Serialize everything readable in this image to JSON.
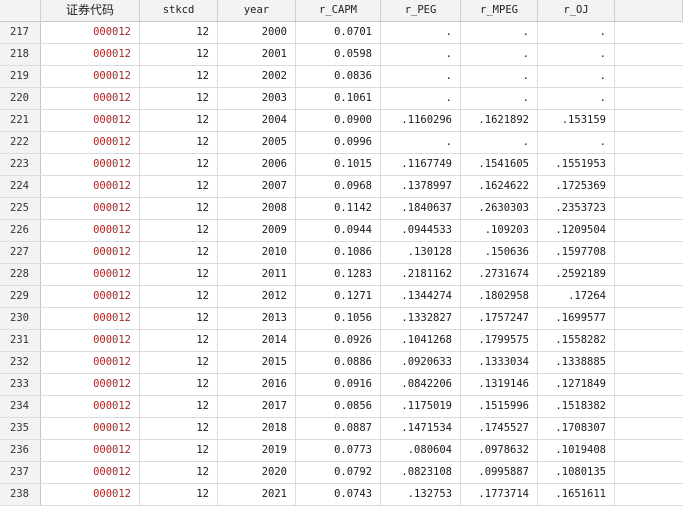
{
  "headers": {
    "code": "证券代码",
    "stkcd": "stkcd",
    "year": "year",
    "r_capm": "r_CAPM",
    "r_peg": "r_PEG",
    "r_mpeg": "r_MPEG",
    "r_oj": "r_OJ"
  },
  "colors": {
    "code_text": "#a52a2a",
    "header_bg": "#f3f3f3",
    "grid_line": "#dcdcdc"
  },
  "rows": [
    {
      "n": "217",
      "code": "000012",
      "stkcd": "12",
      "year": "2000",
      "r_capm": "0.0701",
      "r_peg": ".",
      "r_mpeg": ".",
      "r_oj": "."
    },
    {
      "n": "218",
      "code": "000012",
      "stkcd": "12",
      "year": "2001",
      "r_capm": "0.0598",
      "r_peg": ".",
      "r_mpeg": ".",
      "r_oj": "."
    },
    {
      "n": "219",
      "code": "000012",
      "stkcd": "12",
      "year": "2002",
      "r_capm": "0.0836",
      "r_peg": ".",
      "r_mpeg": ".",
      "r_oj": "."
    },
    {
      "n": "220",
      "code": "000012",
      "stkcd": "12",
      "year": "2003",
      "r_capm": "0.1061",
      "r_peg": ".",
      "r_mpeg": ".",
      "r_oj": "."
    },
    {
      "n": "221",
      "code": "000012",
      "stkcd": "12",
      "year": "2004",
      "r_capm": "0.0900",
      "r_peg": ".1160296",
      "r_mpeg": ".1621892",
      "r_oj": ".153159"
    },
    {
      "n": "222",
      "code": "000012",
      "stkcd": "12",
      "year": "2005",
      "r_capm": "0.0996",
      "r_peg": ".",
      "r_mpeg": ".",
      "r_oj": "."
    },
    {
      "n": "223",
      "code": "000012",
      "stkcd": "12",
      "year": "2006",
      "r_capm": "0.1015",
      "r_peg": ".1167749",
      "r_mpeg": ".1541605",
      "r_oj": ".1551953"
    },
    {
      "n": "224",
      "code": "000012",
      "stkcd": "12",
      "year": "2007",
      "r_capm": "0.0968",
      "r_peg": ".1378997",
      "r_mpeg": ".1624622",
      "r_oj": ".1725369"
    },
    {
      "n": "225",
      "code": "000012",
      "stkcd": "12",
      "year": "2008",
      "r_capm": "0.1142",
      "r_peg": ".1840637",
      "r_mpeg": ".2630303",
      "r_oj": ".2353723"
    },
    {
      "n": "226",
      "code": "000012",
      "stkcd": "12",
      "year": "2009",
      "r_capm": "0.0944",
      "r_peg": ".0944533",
      "r_mpeg": ".109203",
      "r_oj": ".1209504"
    },
    {
      "n": "227",
      "code": "000012",
      "stkcd": "12",
      "year": "2010",
      "r_capm": "0.1086",
      "r_peg": ".130128",
      "r_mpeg": ".150636",
      "r_oj": ".1597708"
    },
    {
      "n": "228",
      "code": "000012",
      "stkcd": "12",
      "year": "2011",
      "r_capm": "0.1283",
      "r_peg": ".2181162",
      "r_mpeg": ".2731674",
      "r_oj": ".2592189"
    },
    {
      "n": "229",
      "code": "000012",
      "stkcd": "12",
      "year": "2012",
      "r_capm": "0.1271",
      "r_peg": ".1344274",
      "r_mpeg": ".1802958",
      "r_oj": ".17264"
    },
    {
      "n": "230",
      "code": "000012",
      "stkcd": "12",
      "year": "2013",
      "r_capm": "0.1056",
      "r_peg": ".1332827",
      "r_mpeg": ".1757247",
      "r_oj": ".1699577"
    },
    {
      "n": "231",
      "code": "000012",
      "stkcd": "12",
      "year": "2014",
      "r_capm": "0.0926",
      "r_peg": ".1041268",
      "r_mpeg": ".1799575",
      "r_oj": ".1558282"
    },
    {
      "n": "232",
      "code": "000012",
      "stkcd": "12",
      "year": "2015",
      "r_capm": "0.0886",
      "r_peg": ".0920633",
      "r_mpeg": ".1333034",
      "r_oj": ".1338885"
    },
    {
      "n": "233",
      "code": "000012",
      "stkcd": "12",
      "year": "2016",
      "r_capm": "0.0916",
      "r_peg": ".0842206",
      "r_mpeg": ".1319146",
      "r_oj": ".1271849"
    },
    {
      "n": "234",
      "code": "000012",
      "stkcd": "12",
      "year": "2017",
      "r_capm": "0.0856",
      "r_peg": ".1175019",
      "r_mpeg": ".1515996",
      "r_oj": ".1518382"
    },
    {
      "n": "235",
      "code": "000012",
      "stkcd": "12",
      "year": "2018",
      "r_capm": "0.0887",
      "r_peg": ".1471534",
      "r_mpeg": ".1745527",
      "r_oj": ".1708307"
    },
    {
      "n": "236",
      "code": "000012",
      "stkcd": "12",
      "year": "2019",
      "r_capm": "0.0773",
      "r_peg": ".080604",
      "r_mpeg": ".0978632",
      "r_oj": ".1019408"
    },
    {
      "n": "237",
      "code": "000012",
      "stkcd": "12",
      "year": "2020",
      "r_capm": "0.0792",
      "r_peg": ".0823108",
      "r_mpeg": ".0995887",
      "r_oj": ".1080135"
    },
    {
      "n": "238",
      "code": "000012",
      "stkcd": "12",
      "year": "2021",
      "r_capm": "0.0743",
      "r_peg": ".132753",
      "r_mpeg": ".1773714",
      "r_oj": ".1651611"
    }
  ]
}
